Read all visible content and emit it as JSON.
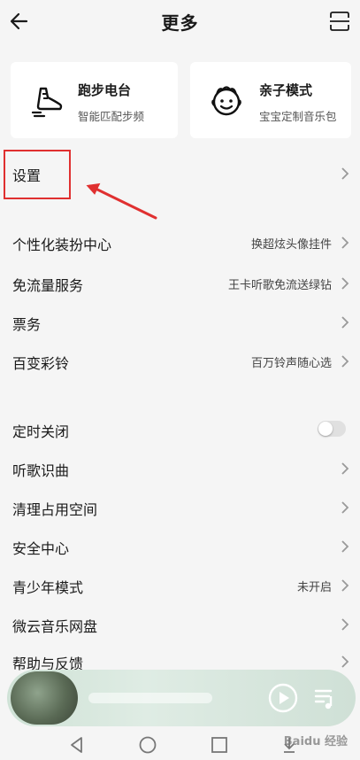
{
  "header": {
    "title": "更多"
  },
  "cards": [
    {
      "title": "跑步电台",
      "subtitle": "智能匹配步频",
      "icon": "running-shoe-icon"
    },
    {
      "title": "亲子模式",
      "subtitle": "宝宝定制音乐包",
      "icon": "baby-face-icon"
    }
  ],
  "settings": {
    "label": "设置"
  },
  "menu_group_1": [
    {
      "label": "个性化装扮中心",
      "value": "换超炫头像挂件"
    },
    {
      "label": "免流量服务",
      "value": "王卡听歌免流送绿钻"
    },
    {
      "label": "票务",
      "value": ""
    },
    {
      "label": "百变彩铃",
      "value": "百万铃声随心选"
    }
  ],
  "menu_group_2": [
    {
      "label": "定时关闭",
      "toggle": false
    },
    {
      "label": "听歌识曲",
      "value": ""
    },
    {
      "label": "清理占用空间",
      "value": ""
    },
    {
      "label": "安全中心",
      "value": ""
    },
    {
      "label": "青少年模式",
      "value": "未开启"
    },
    {
      "label": "微云音乐网盘",
      "value": ""
    },
    {
      "label": "帮助与反馈",
      "value": ""
    }
  ],
  "watermark": "Baidu 经验",
  "colors": {
    "highlight": "#e03030",
    "background": "#f5f5f5"
  }
}
